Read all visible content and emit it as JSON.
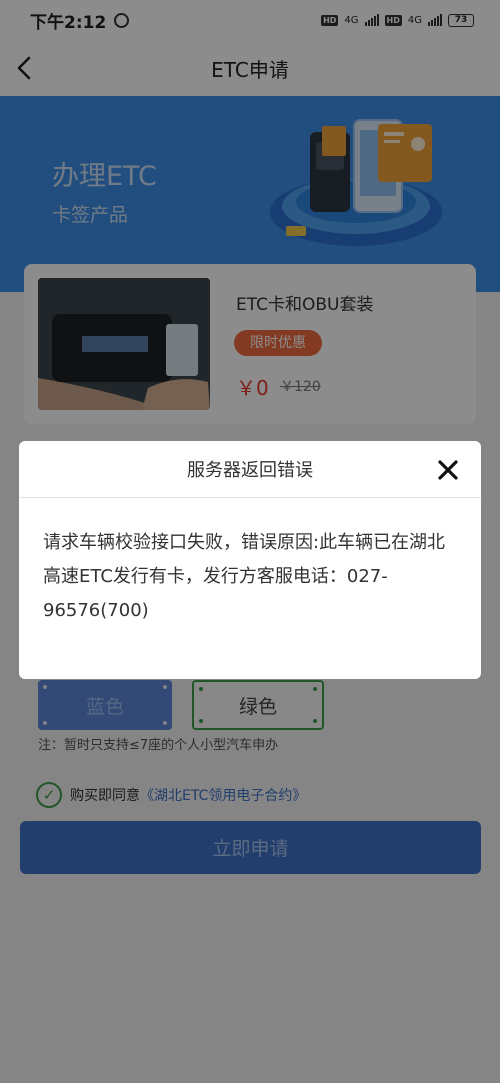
{
  "statusbar": {
    "time": "下午2:12",
    "network1": "4G",
    "network2": "4G",
    "hd_label": "HD",
    "battery": "73"
  },
  "navbar": {
    "title": "ETC申请"
  },
  "banner": {
    "title": "办理ETC",
    "subtitle": "卡签产品"
  },
  "product": {
    "name": "ETC卡和OBU套装",
    "promo_tag": "限时优惠",
    "price": "￥0",
    "old_price": "￥120"
  },
  "plate_colors": {
    "blue_label": "蓝色",
    "green_label": "绿色",
    "selected": "绿色"
  },
  "note": "注：暂时只支持≤7座的个人小型汽车申办",
  "agreement": {
    "checked": true,
    "prefix": "购买即同意",
    "contract_link": "《湖北ETC领用电子合约》"
  },
  "apply_button": "立即申请",
  "dialog": {
    "title": "服务器返回错误",
    "message": "请求车辆校验接口失败，错误原因:此车辆已在湖北高速ETC发行有卡，发行方客服电话：027-96576(700)"
  },
  "colors": {
    "banner": "#3d8ee5",
    "primary": "#3d72c6",
    "promo": "#ee6a3e",
    "price": "#e53a2f",
    "green_plate": "#3c9c4d"
  }
}
